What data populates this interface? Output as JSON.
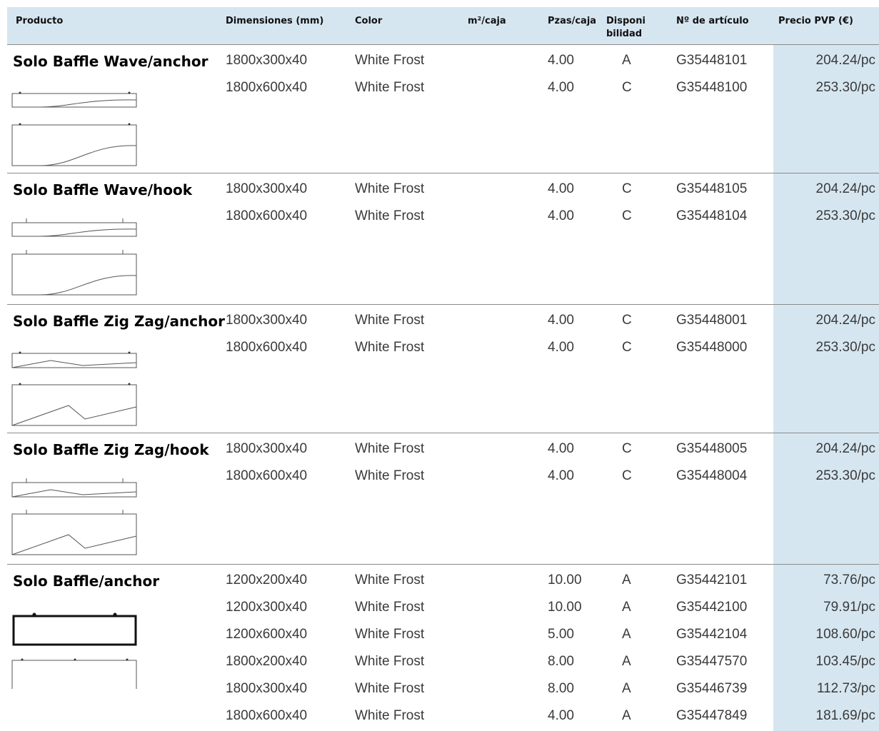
{
  "headers": {
    "producto": "Producto",
    "dimensiones": "Dimensiones (mm)",
    "color": "Color",
    "m2caja": "m²/caja",
    "pzas": "Pzas/caja",
    "disponibilidad_line1": "Disponi",
    "disponibilidad_line2": "bilidad",
    "articulo": "Nº de artículo",
    "precio": "Precio PVP (€)"
  },
  "groups": [
    {
      "name": "Solo Baffle Wave/anchor",
      "rows": [
        {
          "dim": "1800x300x40",
          "color": "White Frost",
          "pzas": "4.00",
          "disp": "A",
          "art": "G35448101",
          "price": "204.24/pc"
        },
        {
          "dim": "1800x600x40",
          "color": "White Frost",
          "pzas": "4.00",
          "disp": "C",
          "art": "G35448100",
          "price": "253.30/pc"
        }
      ]
    },
    {
      "name": "Solo Baffle Wave/hook",
      "rows": [
        {
          "dim": "1800x300x40",
          "color": "White Frost",
          "pzas": "4.00",
          "disp": "C",
          "art": "G35448105",
          "price": "204.24/pc"
        },
        {
          "dim": "1800x600x40",
          "color": "White Frost",
          "pzas": "4.00",
          "disp": "C",
          "art": "G35448104",
          "price": "253.30/pc"
        }
      ]
    },
    {
      "name": "Solo Baffle Zig Zag/anchor",
      "rows": [
        {
          "dim": "1800x300x40",
          "color": "White Frost",
          "pzas": "4.00",
          "disp": "C",
          "art": "G35448001",
          "price": "204.24/pc"
        },
        {
          "dim": "1800x600x40",
          "color": "White Frost",
          "pzas": "4.00",
          "disp": "C",
          "art": "G35448000",
          "price": "253.30/pc"
        }
      ]
    },
    {
      "name": "Solo Baffle Zig Zag/hook",
      "rows": [
        {
          "dim": "1800x300x40",
          "color": "White Frost",
          "pzas": "4.00",
          "disp": "C",
          "art": "G35448005",
          "price": "204.24/pc"
        },
        {
          "dim": "1800x600x40",
          "color": "White Frost",
          "pzas": "4.00",
          "disp": "C",
          "art": "G35448004",
          "price": "253.30/pc"
        }
      ]
    },
    {
      "name": "Solo Baffle/anchor",
      "rows": [
        {
          "dim": "1200x200x40",
          "color": "White Frost",
          "pzas": "10.00",
          "disp": "A",
          "art": "G35442101",
          "price": "73.76/pc"
        },
        {
          "dim": "1200x300x40",
          "color": "White Frost",
          "pzas": "10.00",
          "disp": "A",
          "art": "G35442100",
          "price": "79.91/pc"
        },
        {
          "dim": "1200x600x40",
          "color": "White Frost",
          "pzas": "5.00",
          "disp": "A",
          "art": "G35442104",
          "price": "108.60/pc"
        },
        {
          "dim": "1800x200x40",
          "color": "White Frost",
          "pzas": "8.00",
          "disp": "A",
          "art": "G35447570",
          "price": "103.45/pc"
        },
        {
          "dim": "1800x300x40",
          "color": "White Frost",
          "pzas": "8.00",
          "disp": "A",
          "art": "G35446739",
          "price": "112.73/pc"
        },
        {
          "dim": "1800x600x40",
          "color": "White Frost",
          "pzas": "4.00",
          "disp": "A",
          "art": "G35447849",
          "price": "181.69/pc"
        }
      ]
    }
  ]
}
